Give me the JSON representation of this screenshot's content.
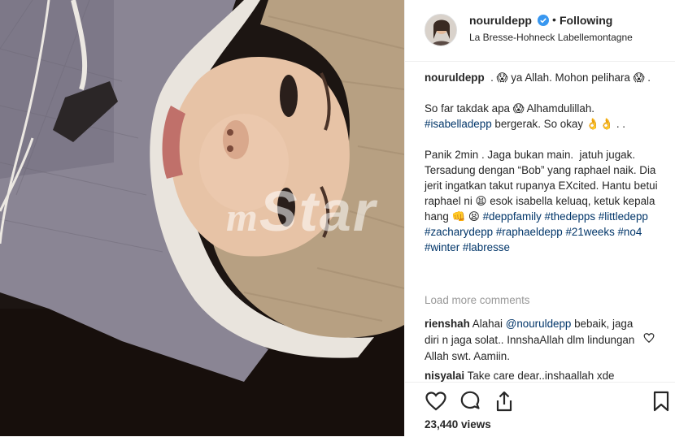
{
  "post": {
    "username": "nouruldepp",
    "follow_separator": "•",
    "follow_status": "Following",
    "location": "La Bresse-Hohneck Labellemontagne",
    "caption_user": "nouruldepp",
    "caption_line1": "️️️️️️ . 😱 ya Allah. Mohon pelihara 😱 .",
    "caption_line2_pre": "So far takdak apa 😱 Alhamdulillah. ",
    "caption_line2_tag": "#isabelladepp",
    "caption_line2_post": " bergerak. So okay 👌👌 . .",
    "caption_line3": "Panik 2min . Jaga bukan main. ️️️ jatuh jugak. Tersadung dengan “Bob” yang raphael naik. Dia jerit ingatkan takut rupanya EXcited. Hantu betui raphael ni 😫 esok isabella keluaq, ketuk kepala hang 👊 😫 ",
    "hashtags": "#deppfamily #thedepps #littledepp #zacharydepp #raphaeldepp #21weeks #no4 #winter #labresse",
    "load_more": "Load more comments",
    "comments": [
      {
        "user": "rienshah",
        "pre": " Alahai ",
        "mention": "@nouruldepp",
        "post": " bebaik, jaga diri n jaga solat.. InnshaAllah dlm lindungan Allah swt. Aamiin."
      },
      {
        "user": "nisyalai",
        "pre": " Take care dear..inshaallah xde",
        "mention": "",
        "post": ""
      }
    ],
    "views": "23,440 views"
  },
  "watermark": {
    "m": "m",
    "text": "Star"
  },
  "icons": {
    "like": "heart-outline-icon",
    "comment": "comment-bubble-icon",
    "share": "share-icon",
    "save": "bookmark-icon",
    "verified": "verified-badge-icon",
    "comment_like": "small-heart-icon"
  },
  "colors": {
    "verified": "#3897f0",
    "link": "#003569",
    "muted": "#999999"
  }
}
